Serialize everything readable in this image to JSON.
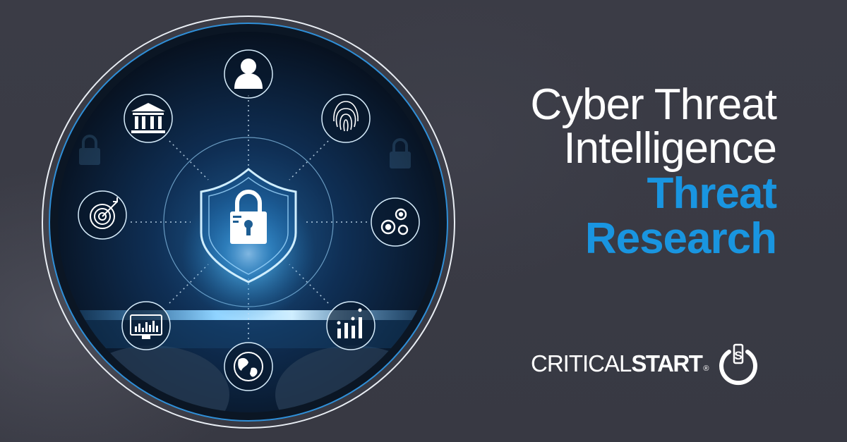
{
  "headline": {
    "line1": "Cyber Threat",
    "line2": "Intelligence",
    "line3": "Threat",
    "line4": "Research"
  },
  "brand": {
    "name_part1": "CRITICAL",
    "name_part2": "START",
    "registered": "®",
    "mark_letter": "S"
  },
  "colors": {
    "background": "#3a3b45",
    "accent": "#1995e0",
    "text": "#ffffff",
    "circle_core": "#0a1a30"
  },
  "icons": [
    "user-icon",
    "fingerprint-icon",
    "gears-icon",
    "chart-icon",
    "globe-icon",
    "monitor-icon",
    "target-icon",
    "bank-icon",
    "shield-lock-icon"
  ]
}
